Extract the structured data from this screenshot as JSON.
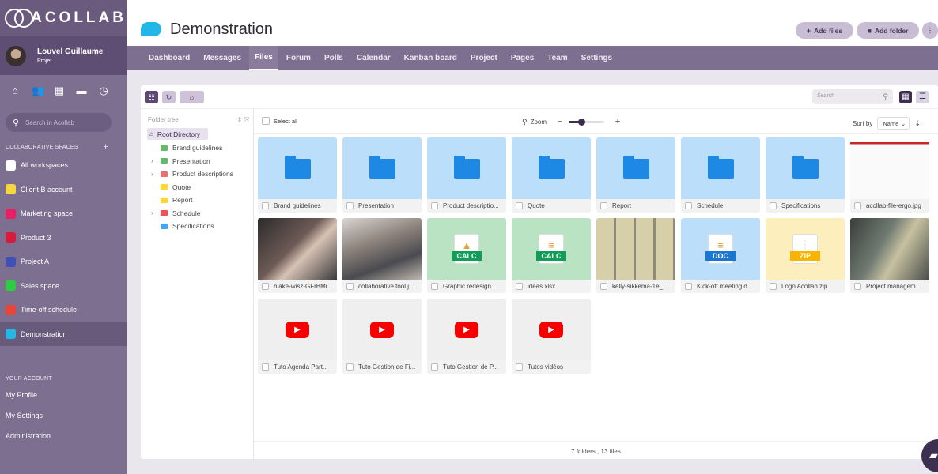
{
  "app": {
    "logo_text": "ACOLLAB"
  },
  "user": {
    "name": "Louvel Guillaume",
    "role": "Projet"
  },
  "sidebar": {
    "search_placeholder": "Search in Acollab",
    "spaces_title": "COLLABORATIVE SPACES",
    "spaces": [
      {
        "label": "All workspaces",
        "color": "#ffffff"
      },
      {
        "label": "Client B account",
        "color": "#f5d742"
      },
      {
        "label": "Marketing space",
        "color": "#e91e63"
      },
      {
        "label": "Product 3",
        "color": "#d81b3a"
      },
      {
        "label": "Project A",
        "color": "#3f51b5"
      },
      {
        "label": "Sales space",
        "color": "#2ecc40"
      },
      {
        "label": "Time-off schedule",
        "color": "#e8443a"
      },
      {
        "label": "Demonstration",
        "color": "#23b7e5"
      }
    ],
    "account_title": "YOUR ACCOUNT",
    "account_items": [
      "My Profile",
      "My Settings",
      "Administration"
    ]
  },
  "header": {
    "title": "Demonstration",
    "add_files": "Add files",
    "add_folder": "Add folder"
  },
  "tabs": [
    "Dashboard",
    "Messages",
    "Files",
    "Forum",
    "Polls",
    "Calendar",
    "Kanban board",
    "Project",
    "Pages",
    "Team",
    "Settings"
  ],
  "files": {
    "search_placeholder": "Search",
    "tree_label": "Folder tree",
    "root": "Root Directory",
    "tree": [
      {
        "label": "Brand guidelines",
        "color": "#66bb6a",
        "expand": false
      },
      {
        "label": "Presentation",
        "color": "#66bb6a",
        "expand": true
      },
      {
        "label": "Product descriptions",
        "color": "#e57373",
        "expand": true
      },
      {
        "label": "Quote",
        "color": "#fdd835",
        "expand": false
      },
      {
        "label": "Report",
        "color": "#fdd835",
        "expand": false
      },
      {
        "label": "Schedule",
        "color": "#ef5350",
        "expand": true
      },
      {
        "label": "Specifications",
        "color": "#42a5f5",
        "expand": false
      }
    ],
    "select_all": "Select all",
    "zoom_label": "Zoom",
    "sort_by": "Sort by",
    "sort_value": "Name",
    "items": [
      {
        "name": "Brand guidelines",
        "kind": "folder"
      },
      {
        "name": "Presentation",
        "kind": "folder"
      },
      {
        "name": "Product descriptio...",
        "kind": "folder"
      },
      {
        "name": "Quote",
        "kind": "folder"
      },
      {
        "name": "Report",
        "kind": "folder"
      },
      {
        "name": "Schedule",
        "kind": "folder"
      },
      {
        "name": "Specifications",
        "kind": "folder"
      },
      {
        "name": "acollab-file-ergo.jpg",
        "kind": "screenshot"
      },
      {
        "name": "blake-wisz-GFrBMi...",
        "kind": "photo1"
      },
      {
        "name": "collaborative tool.j...",
        "kind": "photo2"
      },
      {
        "name": "Graphic redesign....",
        "kind": "calc",
        "badge": "CALC"
      },
      {
        "name": "ideas.xlsx",
        "kind": "calc2",
        "badge": "CALC"
      },
      {
        "name": "kelly-sikkema-1e_...",
        "kind": "photo3"
      },
      {
        "name": "Kick-off meeting.d...",
        "kind": "doc",
        "badge": "DOC"
      },
      {
        "name": "Logo Acollab.zip",
        "kind": "zip",
        "badge": "ZIP"
      },
      {
        "name": "Project managem...",
        "kind": "photo4"
      },
      {
        "name": "Tuto Agenda Part...",
        "kind": "video"
      },
      {
        "name": "Tuto Gestion de Fi...",
        "kind": "video"
      },
      {
        "name": "Tuto Gestion de P...",
        "kind": "video"
      },
      {
        "name": "Tutos vidéos",
        "kind": "video"
      }
    ],
    "footer": "7 folders , 13 files"
  }
}
